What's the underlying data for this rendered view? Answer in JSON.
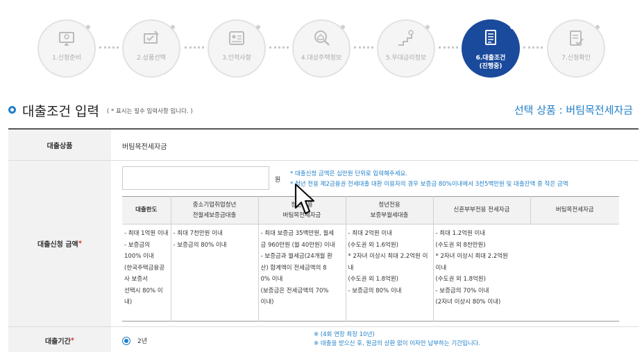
{
  "stepper": {
    "steps": [
      {
        "label": "1.신청준비",
        "icon": "monitor-icon"
      },
      {
        "label": "2.상품선택",
        "icon": "product-select-icon"
      },
      {
        "label": "3.인적사항",
        "icon": "id-card-icon"
      },
      {
        "label": "4.대상주택정보",
        "icon": "house-search-icon"
      },
      {
        "label": "5.우대금리정보",
        "icon": "coin-stairs-icon"
      },
      {
        "label": "6.대출조건",
        "sublabel": "(진행중)",
        "icon": "document-icon",
        "active": true
      },
      {
        "label": "7.신청확인",
        "icon": "checklist-icon"
      }
    ],
    "active_color": "#1a4a9c"
  },
  "heading": {
    "title": "대출조건 입력",
    "hint": "( * 표시는 필수 입력사항 입니다. )",
    "selected_product": "선택 상품 : 버팀목전세자금"
  },
  "form": {
    "product_label": "대출상품",
    "product_value": "버팀목전세자금",
    "amount_label": "대출신청 금액",
    "amount_required": "*",
    "amount_value": "",
    "amount_unit": "원",
    "amount_notes": [
      "* 대출신청 금액은 십만원 단위로 입력해주세요.",
      "* 청년 전용 제2금융권 전세대출 대환 이용자의 경우 보증금 80%이내에서 3천5백만원 및 대출잔액 중 작은 금액"
    ],
    "limit_table": {
      "row_header": "대출한도",
      "columns": [
        {
          "title": "중소기업취업청년\n전월세보증금대출",
          "lines": [
            "- 최대 1억원 이내",
            "- 보증금의 100% 이내",
            "(한국주택금융공사 보증서",
            "선택시 80% 이내)"
          ]
        },
        {
          "title": "청년전용\n버팀목전세자금",
          "lines": [
            "- 최대 7천만원 이내",
            "- 보증금의 80% 이내"
          ]
        },
        {
          "title": "청년전용\n보증부월세대출",
          "lines": [
            "- 최대 보증금 35백만원, 월세",
            "금 960만원 (월 40만원) 이내",
            "- 보증금과 월세금(24개월 환",
            "산) 합계액이 전세금액의 8",
            "0% 이내",
            "(보증금은 전세금액의 70%",
            "이내)"
          ]
        },
        {
          "title": "신혼부부전용 전세자금",
          "lines": [
            "- 최대 2억원 이내",
            "(수도권 외 1.6억원)",
            "* 2자녀 이상시 최대 2.2억원 이",
            "내",
            " (수도권 외 1.8억원)",
            "- 보증금의 80% 이내"
          ]
        },
        {
          "title": "버팀목전세자금",
          "lines": [
            "- 최대 1.2억원 이내",
            "(수도권 외 8천만원)",
            "* 2자녀 이상시 최대 2.2억원",
            "이내",
            "(수도권 외 1.8억원)",
            "- 보증금의 70% 이내",
            "(2자녀 이상시 80% 이내)"
          ]
        }
      ]
    },
    "period_label": "대출기간",
    "period_required": "*",
    "period_value": "2년",
    "period_notes": [
      "※ (4회 연장 최장 10년)",
      "※ 대출을 받으신 후, 원금의 상환 없이 이자만 납부하는 기간입니다."
    ]
  },
  "colors": {
    "accent": "#1f7fc8",
    "required": "#dd3333"
  }
}
